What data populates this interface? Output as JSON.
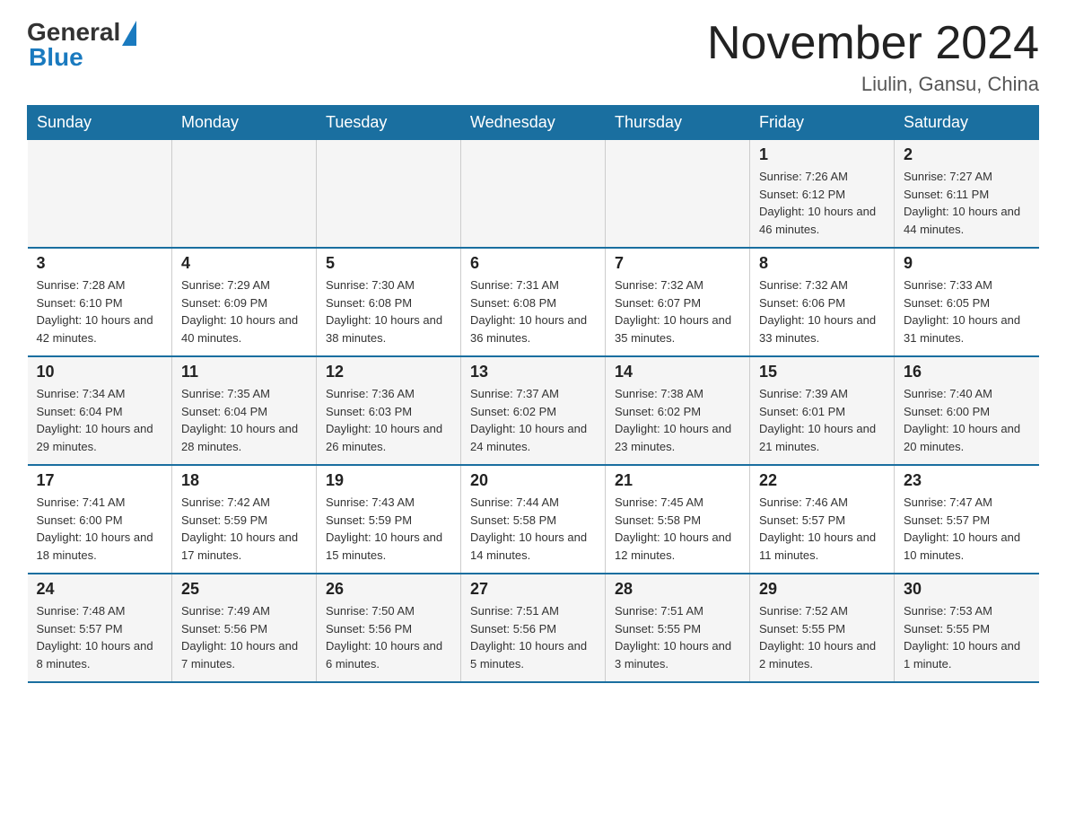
{
  "header": {
    "logo_general": "General",
    "logo_blue": "Blue",
    "month_title": "November 2024",
    "location": "Liulin, Gansu, China"
  },
  "weekdays": [
    "Sunday",
    "Monday",
    "Tuesday",
    "Wednesday",
    "Thursday",
    "Friday",
    "Saturday"
  ],
  "weeks": [
    {
      "days": [
        {
          "number": "",
          "info": ""
        },
        {
          "number": "",
          "info": ""
        },
        {
          "number": "",
          "info": ""
        },
        {
          "number": "",
          "info": ""
        },
        {
          "number": "",
          "info": ""
        },
        {
          "number": "1",
          "info": "Sunrise: 7:26 AM\nSunset: 6:12 PM\nDaylight: 10 hours and 46 minutes."
        },
        {
          "number": "2",
          "info": "Sunrise: 7:27 AM\nSunset: 6:11 PM\nDaylight: 10 hours and 44 minutes."
        }
      ]
    },
    {
      "days": [
        {
          "number": "3",
          "info": "Sunrise: 7:28 AM\nSunset: 6:10 PM\nDaylight: 10 hours and 42 minutes."
        },
        {
          "number": "4",
          "info": "Sunrise: 7:29 AM\nSunset: 6:09 PM\nDaylight: 10 hours and 40 minutes."
        },
        {
          "number": "5",
          "info": "Sunrise: 7:30 AM\nSunset: 6:08 PM\nDaylight: 10 hours and 38 minutes."
        },
        {
          "number": "6",
          "info": "Sunrise: 7:31 AM\nSunset: 6:08 PM\nDaylight: 10 hours and 36 minutes."
        },
        {
          "number": "7",
          "info": "Sunrise: 7:32 AM\nSunset: 6:07 PM\nDaylight: 10 hours and 35 minutes."
        },
        {
          "number": "8",
          "info": "Sunrise: 7:32 AM\nSunset: 6:06 PM\nDaylight: 10 hours and 33 minutes."
        },
        {
          "number": "9",
          "info": "Sunrise: 7:33 AM\nSunset: 6:05 PM\nDaylight: 10 hours and 31 minutes."
        }
      ]
    },
    {
      "days": [
        {
          "number": "10",
          "info": "Sunrise: 7:34 AM\nSunset: 6:04 PM\nDaylight: 10 hours and 29 minutes."
        },
        {
          "number": "11",
          "info": "Sunrise: 7:35 AM\nSunset: 6:04 PM\nDaylight: 10 hours and 28 minutes."
        },
        {
          "number": "12",
          "info": "Sunrise: 7:36 AM\nSunset: 6:03 PM\nDaylight: 10 hours and 26 minutes."
        },
        {
          "number": "13",
          "info": "Sunrise: 7:37 AM\nSunset: 6:02 PM\nDaylight: 10 hours and 24 minutes."
        },
        {
          "number": "14",
          "info": "Sunrise: 7:38 AM\nSunset: 6:02 PM\nDaylight: 10 hours and 23 minutes."
        },
        {
          "number": "15",
          "info": "Sunrise: 7:39 AM\nSunset: 6:01 PM\nDaylight: 10 hours and 21 minutes."
        },
        {
          "number": "16",
          "info": "Sunrise: 7:40 AM\nSunset: 6:00 PM\nDaylight: 10 hours and 20 minutes."
        }
      ]
    },
    {
      "days": [
        {
          "number": "17",
          "info": "Sunrise: 7:41 AM\nSunset: 6:00 PM\nDaylight: 10 hours and 18 minutes."
        },
        {
          "number": "18",
          "info": "Sunrise: 7:42 AM\nSunset: 5:59 PM\nDaylight: 10 hours and 17 minutes."
        },
        {
          "number": "19",
          "info": "Sunrise: 7:43 AM\nSunset: 5:59 PM\nDaylight: 10 hours and 15 minutes."
        },
        {
          "number": "20",
          "info": "Sunrise: 7:44 AM\nSunset: 5:58 PM\nDaylight: 10 hours and 14 minutes."
        },
        {
          "number": "21",
          "info": "Sunrise: 7:45 AM\nSunset: 5:58 PM\nDaylight: 10 hours and 12 minutes."
        },
        {
          "number": "22",
          "info": "Sunrise: 7:46 AM\nSunset: 5:57 PM\nDaylight: 10 hours and 11 minutes."
        },
        {
          "number": "23",
          "info": "Sunrise: 7:47 AM\nSunset: 5:57 PM\nDaylight: 10 hours and 10 minutes."
        }
      ]
    },
    {
      "days": [
        {
          "number": "24",
          "info": "Sunrise: 7:48 AM\nSunset: 5:57 PM\nDaylight: 10 hours and 8 minutes."
        },
        {
          "number": "25",
          "info": "Sunrise: 7:49 AM\nSunset: 5:56 PM\nDaylight: 10 hours and 7 minutes."
        },
        {
          "number": "26",
          "info": "Sunrise: 7:50 AM\nSunset: 5:56 PM\nDaylight: 10 hours and 6 minutes."
        },
        {
          "number": "27",
          "info": "Sunrise: 7:51 AM\nSunset: 5:56 PM\nDaylight: 10 hours and 5 minutes."
        },
        {
          "number": "28",
          "info": "Sunrise: 7:51 AM\nSunset: 5:55 PM\nDaylight: 10 hours and 3 minutes."
        },
        {
          "number": "29",
          "info": "Sunrise: 7:52 AM\nSunset: 5:55 PM\nDaylight: 10 hours and 2 minutes."
        },
        {
          "number": "30",
          "info": "Sunrise: 7:53 AM\nSunset: 5:55 PM\nDaylight: 10 hours and 1 minute."
        }
      ]
    }
  ]
}
